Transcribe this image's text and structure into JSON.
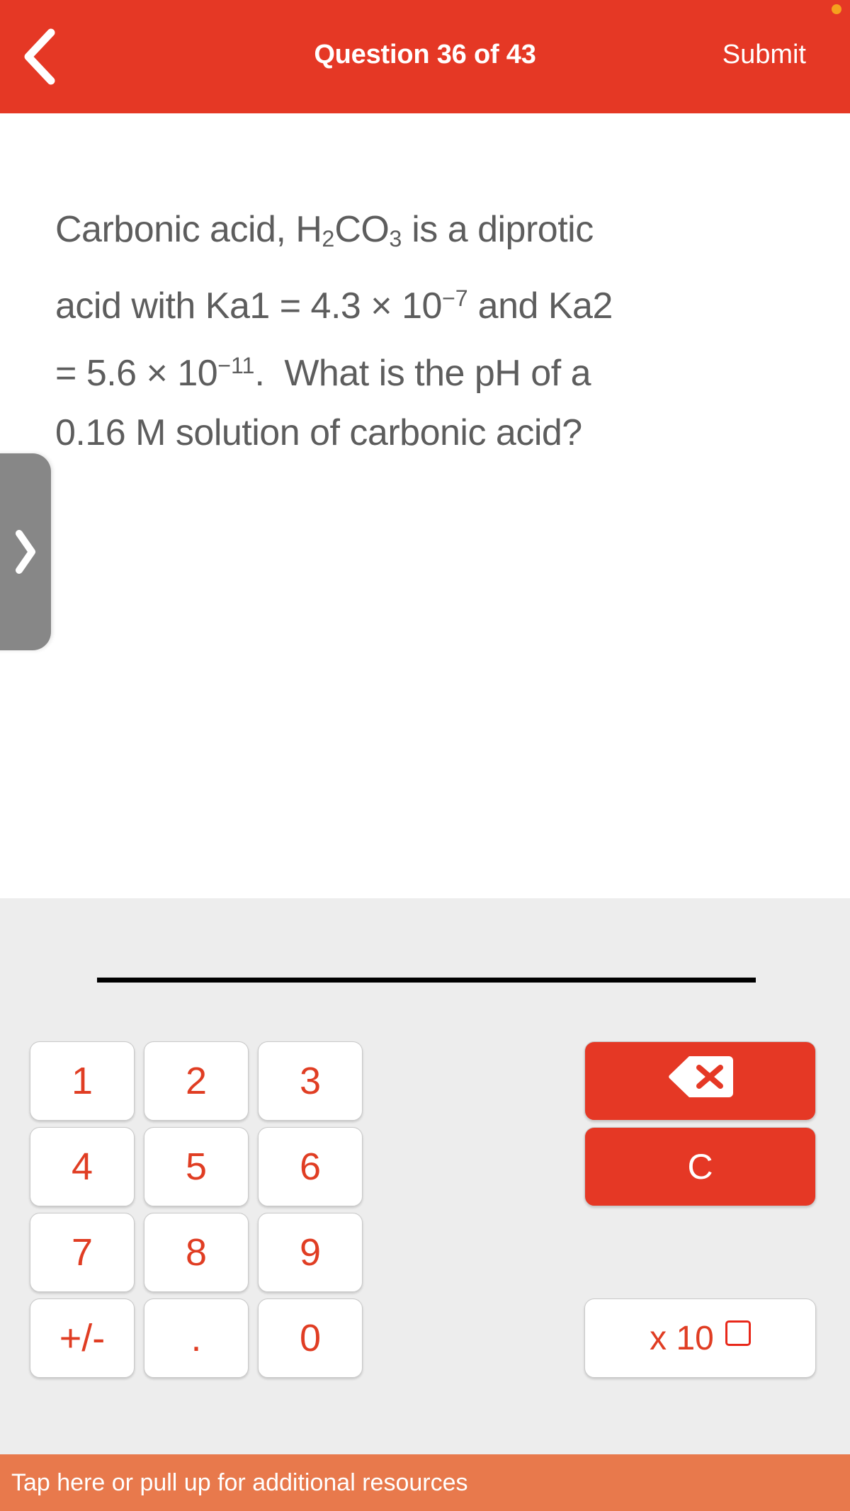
{
  "header": {
    "back_icon": "chevron-left-icon",
    "title": "Question 36 of 43",
    "submit_label": "Submit",
    "notification_dot_color": "#f5a11d",
    "background_color": "#e53825"
  },
  "question": {
    "lines": [
      "Carbonic acid, H2CO3 is a diprotic",
      "acid with Ka1 = 4.3 × 10-7 and Ka2",
      "= 5.6 × 10-11.  What is the pH of a",
      "0.16 M solution of carbonic acid?"
    ],
    "plain_text": "Carbonic acid, H₂CO₃ is a diprotic acid with Ka1 = 4.3 × 10⁻⁷ and Ka2 = 5.6 × 10⁻¹¹.  What is the pH of a 0.16 M solution of carbonic acid?",
    "seg": {
      "l1a": "Carbonic acid, H",
      "l1b": "2",
      "l1c": "CO",
      "l1d": "3",
      "l1e": " is a diprotic",
      "l2a": "acid with Ka1 = 4.3 × 10",
      "l2b": "−7",
      "l2c": " and Ka2",
      "l3a": "= 5.6 × 10",
      "l3b": "−11",
      "l3c": ".  What is the pH of a",
      "l4a": "0.16 M solution of carbonic acid?"
    },
    "text_color": "#5d5d5d"
  },
  "side_tab": {
    "icon": "chevron-right-icon",
    "color": "#878787"
  },
  "answer": {
    "value": "",
    "line_color": "#000000"
  },
  "keypad": {
    "background_color": "#ededed",
    "number_text_color": "#e03d23",
    "accent_color": "#e53825",
    "keys": [
      {
        "id": "key-1",
        "label": "1",
        "type": "number"
      },
      {
        "id": "key-2",
        "label": "2",
        "type": "number"
      },
      {
        "id": "key-3",
        "label": "3",
        "type": "number"
      },
      {
        "id": "key-4",
        "label": "4",
        "type": "number"
      },
      {
        "id": "key-5",
        "label": "5",
        "type": "number"
      },
      {
        "id": "key-6",
        "label": "6",
        "type": "number"
      },
      {
        "id": "key-7",
        "label": "7",
        "type": "number"
      },
      {
        "id": "key-8",
        "label": "8",
        "type": "number"
      },
      {
        "id": "key-9",
        "label": "9",
        "type": "number"
      },
      {
        "id": "key-sign",
        "label": "+/-",
        "type": "number"
      },
      {
        "id": "key-decimal",
        "label": ".",
        "type": "number"
      },
      {
        "id": "key-0",
        "label": "0",
        "type": "number"
      }
    ],
    "backspace": {
      "icon": "backspace-icon",
      "label": ""
    },
    "clear": {
      "label": "C"
    },
    "exponent": {
      "label": "x 10",
      "box": "exponent-placeholder"
    }
  },
  "bottom_bar": {
    "label": "Tap here or pull up for additional resources",
    "background_color": "#e8794c"
  }
}
